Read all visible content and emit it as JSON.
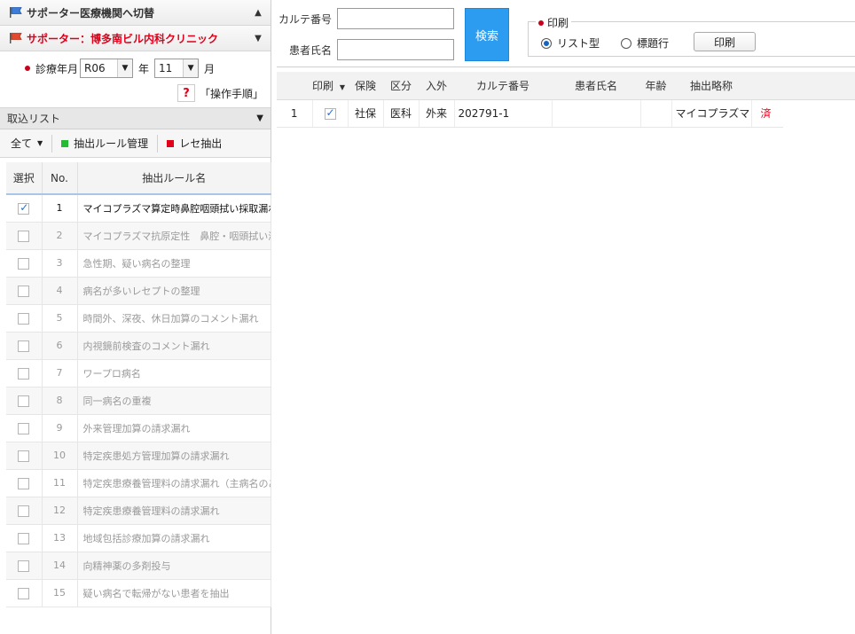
{
  "sidebar": {
    "switch_label": "サポーター医療機関へ切替",
    "supporter_label": "サポーター：博多南ビル内科クリニック",
    "period": {
      "label": "診療年月",
      "era_value": "R06",
      "year_suffix": "年",
      "month_value": "11",
      "month_suffix": "月"
    },
    "help_label": "「操作手順」",
    "import_list_label": "取込リスト",
    "toolbar": {
      "all_label": "全て",
      "manage_label": "抽出ルール管理",
      "extract_label": "レセ抽出"
    },
    "table": {
      "headers": [
        "選択",
        "No.",
        "抽出ルール名"
      ],
      "rows": [
        {
          "checked": true,
          "no": "1",
          "name": "マイコプラズマ算定時鼻腔咽頭拭い採取漏れ"
        },
        {
          "checked": false,
          "no": "2",
          "name": "マイコプラズマ抗原定性　鼻腔・咽頭拭い液"
        },
        {
          "checked": false,
          "no": "3",
          "name": "急性期、疑い病名の整理"
        },
        {
          "checked": false,
          "no": "4",
          "name": "病名が多いレセプトの整理"
        },
        {
          "checked": false,
          "no": "5",
          "name": "時間外、深夜、休日加算のコメント漏れ"
        },
        {
          "checked": false,
          "no": "6",
          "name": "内視鏡前検査のコメント漏れ"
        },
        {
          "checked": false,
          "no": "7",
          "name": "ワープロ病名"
        },
        {
          "checked": false,
          "no": "8",
          "name": "同一病名の重複"
        },
        {
          "checked": false,
          "no": "9",
          "name": "外来管理加算の請求漏れ"
        },
        {
          "checked": false,
          "no": "10",
          "name": "特定疾患処方管理加算の請求漏れ"
        },
        {
          "checked": false,
          "no": "11",
          "name": "特定疾患療養管理料の請求漏れ（主病名のあ"
        },
        {
          "checked": false,
          "no": "12",
          "name": "特定疾患療養管理料の請求漏れ"
        },
        {
          "checked": false,
          "no": "13",
          "name": "地域包括診療加算の請求漏れ"
        },
        {
          "checked": false,
          "no": "14",
          "name": "向精神薬の多剤投与"
        },
        {
          "checked": false,
          "no": "15",
          "name": "疑い病名で転帰がない患者を抽出"
        }
      ]
    }
  },
  "search": {
    "karte_label": "カルテ番号",
    "karte_value": "",
    "patient_label": "患者氏名",
    "patient_value": "",
    "search_button": "検索",
    "print_group_label": "印刷",
    "radio_list": "リスト型",
    "radio_title": "標題行",
    "print_button": "印刷"
  },
  "results": {
    "headers": [
      "印刷",
      "保険",
      "区分",
      "入外",
      "カルテ番号",
      "患者氏名",
      "年齢",
      "抽出略称"
    ],
    "rows": [
      {
        "no": "1",
        "print": true,
        "insurance": "社保",
        "category": "医科",
        "inout": "外来",
        "karte": "202791-1",
        "name": "",
        "age": "",
        "abbr": "マイコプラズマ",
        "status": "済"
      }
    ]
  },
  "colors": {
    "accent": "#2c9cf0",
    "supporter_red": "#e0001a",
    "manage_green": "#22bb33",
    "extract_red": "#e0001a"
  }
}
